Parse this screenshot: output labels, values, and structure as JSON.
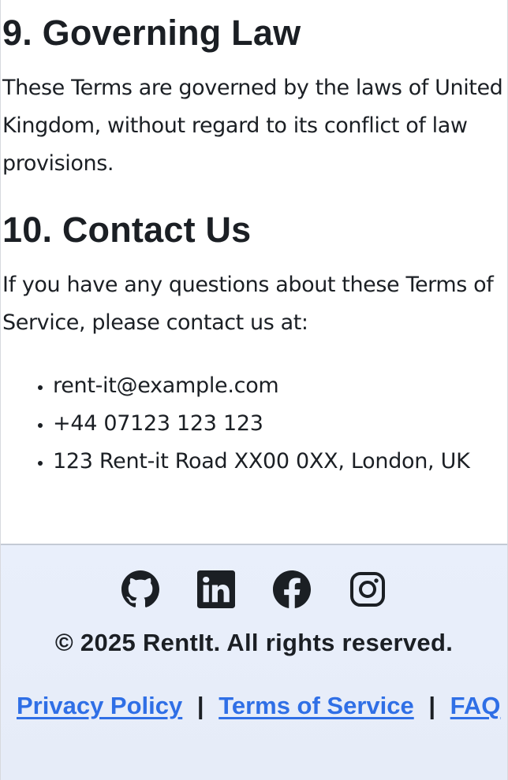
{
  "sections": {
    "governing_law": {
      "heading": "9. Governing Law",
      "body": "These Terms are governed by the laws of United Kingdom, without regard to its conflict of law provisions."
    },
    "contact": {
      "heading": "10. Contact Us",
      "body": "If you have any questions about these Terms of Service, please contact us at:",
      "items": [
        "rent-it@example.com",
        "+44 07123 123 123",
        "123 Rent-it Road XX00 0XX, London, UK"
      ]
    }
  },
  "footer": {
    "social_icons": [
      "github-icon",
      "linkedin-icon",
      "facebook-icon",
      "instagram-icon"
    ],
    "copyright": "© 2025 RentIt. All rights reserved.",
    "links": {
      "privacy": "Privacy Policy",
      "terms": "Terms of Service",
      "faq": "FAQ",
      "separator": "|"
    },
    "colors": {
      "background": "#e9effb",
      "link": "#2f6fe6"
    }
  }
}
